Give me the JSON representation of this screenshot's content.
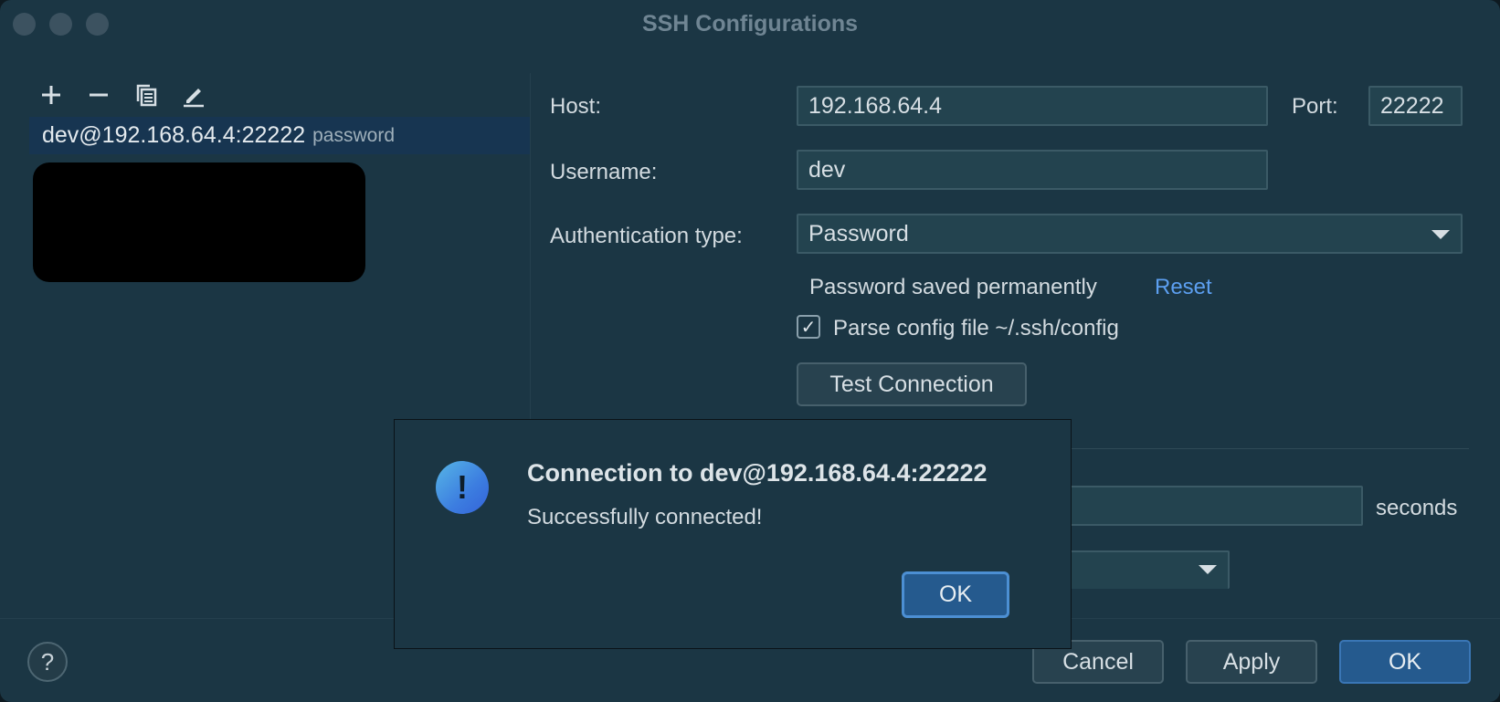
{
  "window": {
    "title": "SSH Configurations"
  },
  "left": {
    "toolbar": {
      "add_icon": "plus-icon",
      "remove_icon": "minus-icon",
      "copy_icon": "copy-icon",
      "edit_icon": "pencil-icon"
    },
    "configs": [
      {
        "name": "dev@192.168.64.4:22222",
        "auth": "password"
      }
    ]
  },
  "form": {
    "host_label": "Host:",
    "host_value": "192.168.64.4",
    "port_label": "Port:",
    "port_value": "22222",
    "username_label": "Username:",
    "username_value": "dev",
    "auth_label": "Authentication type:",
    "auth_value": "Password",
    "password_status": "Password saved permanently",
    "reset_link": "Reset",
    "parse_config_label": "Parse config file ~/.ssh/config",
    "parse_config_checked": true,
    "test_connection": "Test Connection",
    "timeout_unit": "seconds"
  },
  "footer": {
    "help": "?",
    "cancel": "Cancel",
    "apply": "Apply",
    "ok": "OK"
  },
  "dialog": {
    "title": "Connection to dev@192.168.64.4:22222",
    "message": "Successfully connected!",
    "ok": "OK",
    "icon": "exclamation-icon"
  }
}
